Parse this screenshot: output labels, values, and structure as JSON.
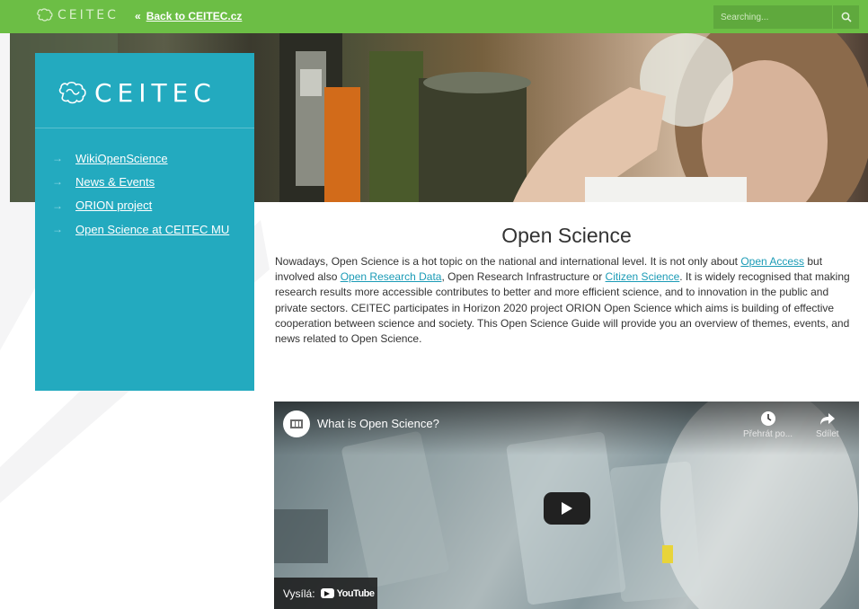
{
  "topbar": {
    "logo_text": "CEITEC",
    "back_prefix": "«",
    "back_label": "Back to CEITEC.cz",
    "search_placeholder": "Searching...",
    "bg_color": "#6cbe45"
  },
  "sidebar": {
    "brand_text": "CEITEC",
    "arrow": "→",
    "bg_color": "#23aabf",
    "items": [
      {
        "label": "WikiOpenScience"
      },
      {
        "label": "News & Events"
      },
      {
        "label": "ORION project"
      },
      {
        "label": "Open Science at CEITEC MU"
      }
    ]
  },
  "main": {
    "title": "Open Science",
    "intro": {
      "t1": "Nowadays, Open Science is a hot topic on the national and international level. It is not only about ",
      "link1": "Open Access",
      "t2": " but involved also ",
      "link2": "Open Research Data",
      "t3": ", Open Research Infrastructure or ",
      "link3": "Citizen Science",
      "t4": ". It is widely recognised that making research results more accessible contributes to better and more efficient science, and to innovation in the public and private sectors. CEITEC participates in Horizon 2020 project ORION Open Science which aims is building of effective cooperation between science and society. This Open Science Guide will provide you an overview of themes, events, and news related to Open Science."
    }
  },
  "video": {
    "title": "What is Open Science?",
    "watch_later_label": "Přehrát po...",
    "share_label": "Sdílet",
    "badge_label": "Vysílá:",
    "youtube_label": "YouTube"
  },
  "icons": {
    "search": "search-icon",
    "logo": "ceitec-logo-icon",
    "clock": "clock-icon",
    "share": "share-icon",
    "play": "play-icon"
  }
}
